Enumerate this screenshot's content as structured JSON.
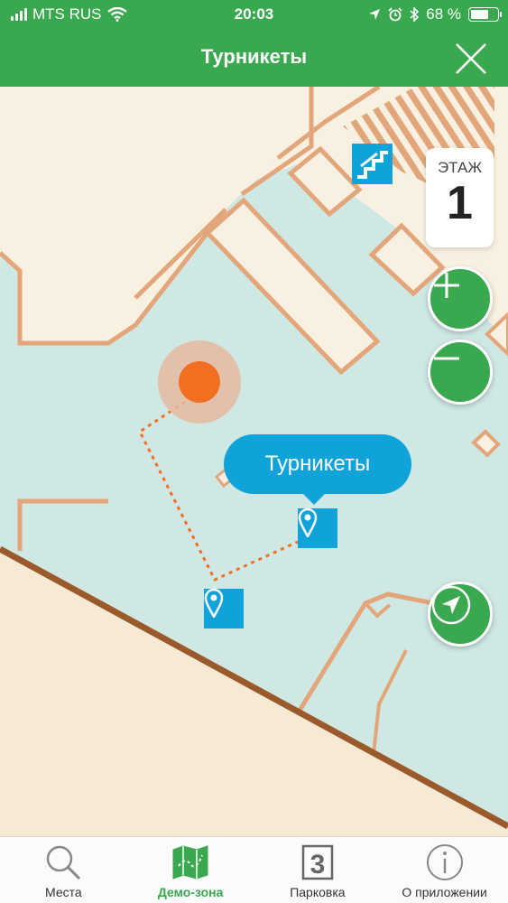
{
  "status_bar": {
    "carrier": "MTS RUS",
    "time": "20:03",
    "battery": "68 %",
    "battery_level": 0.68,
    "icons": [
      "signal-icon",
      "wifi-icon",
      "location-arrow-icon",
      "alarm-icon",
      "bluetooth-icon",
      "battery-icon"
    ]
  },
  "header": {
    "title": "Турникеты",
    "close_icon": "close-icon"
  },
  "map": {
    "floor_label": "ЭТАЖ",
    "floor_number": "1",
    "callout_label": "Турникеты",
    "zoom_in_icon": "plus-icon",
    "zoom_out_icon": "minus-icon",
    "locate_icon": "navigation-arrow-icon",
    "colors": {
      "background": "#cfe8e4",
      "building": "#f8f0e0",
      "walls": "#e3a67a",
      "outer_wall": "#9a5a2c",
      "route": "#f26f21",
      "pin": "#0fa3d9",
      "accent": "#3aa84e"
    }
  },
  "tabs": [
    {
      "label": "Места",
      "icon": "search-icon",
      "active": false
    },
    {
      "label": "Демо-зона",
      "icon": "map-icon",
      "active": true
    },
    {
      "label": "Парковка",
      "icon": "parking-3-icon",
      "active": false
    },
    {
      "label": "О приложении",
      "icon": "info-icon",
      "active": false
    }
  ]
}
